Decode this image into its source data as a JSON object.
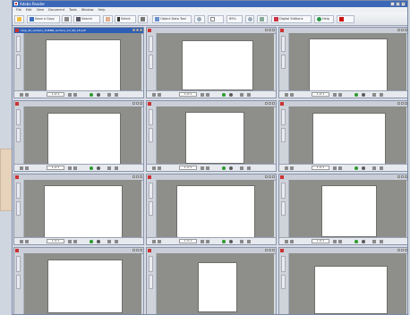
{
  "window": {
    "title": "Adobe Reader"
  },
  "menu": [
    "File",
    "Edit",
    "View",
    "Document",
    "Tools",
    "Window",
    "Help"
  ],
  "toolbar": {
    "save_copy": "Save a Copy",
    "search": "Search",
    "select": "Select",
    "snapshot": "Snapshot",
    "object_data_tool": "Object Data Tool",
    "zoom": "69%",
    "digital_editions": "Digital Editions",
    "help": "Help"
  },
  "documents": [
    {
      "title": "map_db_oenters_1OBMB_surface_1O_SD_1E.pdf",
      "page": "1 of 1",
      "content": "orange-map"
    },
    {
      "title": "",
      "page": "1 of 1",
      "content": "line-map"
    },
    {
      "title": "",
      "page": "1 of 1",
      "content": "dot-map"
    },
    {
      "title": "",
      "page": "1 of 1",
      "content": "dot-map"
    },
    {
      "title": "",
      "page": "1 of 1",
      "content": "photo-map"
    },
    {
      "title": "",
      "page": "1 of 1",
      "content": "faint-map"
    },
    {
      "title": "",
      "page": "1 of 1",
      "content": "green-map"
    },
    {
      "title": "",
      "page": "1 of 1",
      "content": "faint-map"
    },
    {
      "title": "",
      "page": "1 of 1",
      "content": "grid-map"
    },
    {
      "title": "",
      "page": "",
      "content": "dark-map"
    },
    {
      "title": "",
      "page": "",
      "content": "blank-page"
    },
    {
      "title": "",
      "page": "",
      "content": "sky-page"
    }
  ],
  "panel_tabs": [
    "Bookmarks",
    "Pages"
  ]
}
